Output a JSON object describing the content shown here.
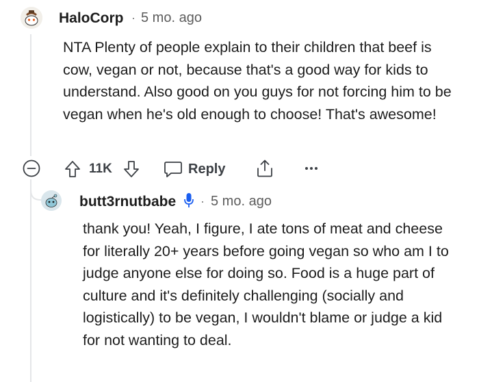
{
  "comment": {
    "author": "HaloCorp",
    "separator": "·",
    "timestamp": "5 mo. ago",
    "body": "NTA Plenty of people explain to their children that beef is cow, vegan or not, because that's a good way for kids to understand. Also good on you guys for not forcing him to be vegan when he's old enough to choose! That's awesome!",
    "vote_count": "11K",
    "reply_label": "Reply"
  },
  "reply": {
    "author": "butt3rnutbabe",
    "separator": "·",
    "timestamp": "5 mo. ago",
    "body": "thank you! Yeah, I figure, I ate tons of meat and cheese for literally 20+ years before going vegan so who am I to judge anyone else for doing so. Food is a huge part of culture and it's definitely challenging (socially and logistically) to be vegan, I wouldn't blame or judge a kid for not wanting to deal."
  },
  "colors": {
    "text": "#1c1c1c",
    "meta": "#5c5c5c",
    "thread_line": "#e4e6e8",
    "icon": "#3b3f44",
    "mic_badge": "#1a5ef0"
  },
  "icons": [
    "snoo-avatar-icon",
    "collapse-thread-icon",
    "upvote-icon",
    "downvote-icon",
    "reply-icon",
    "share-icon",
    "more-options-icon",
    "mic-badge-icon",
    "snoo-avatar-reply-icon"
  ]
}
